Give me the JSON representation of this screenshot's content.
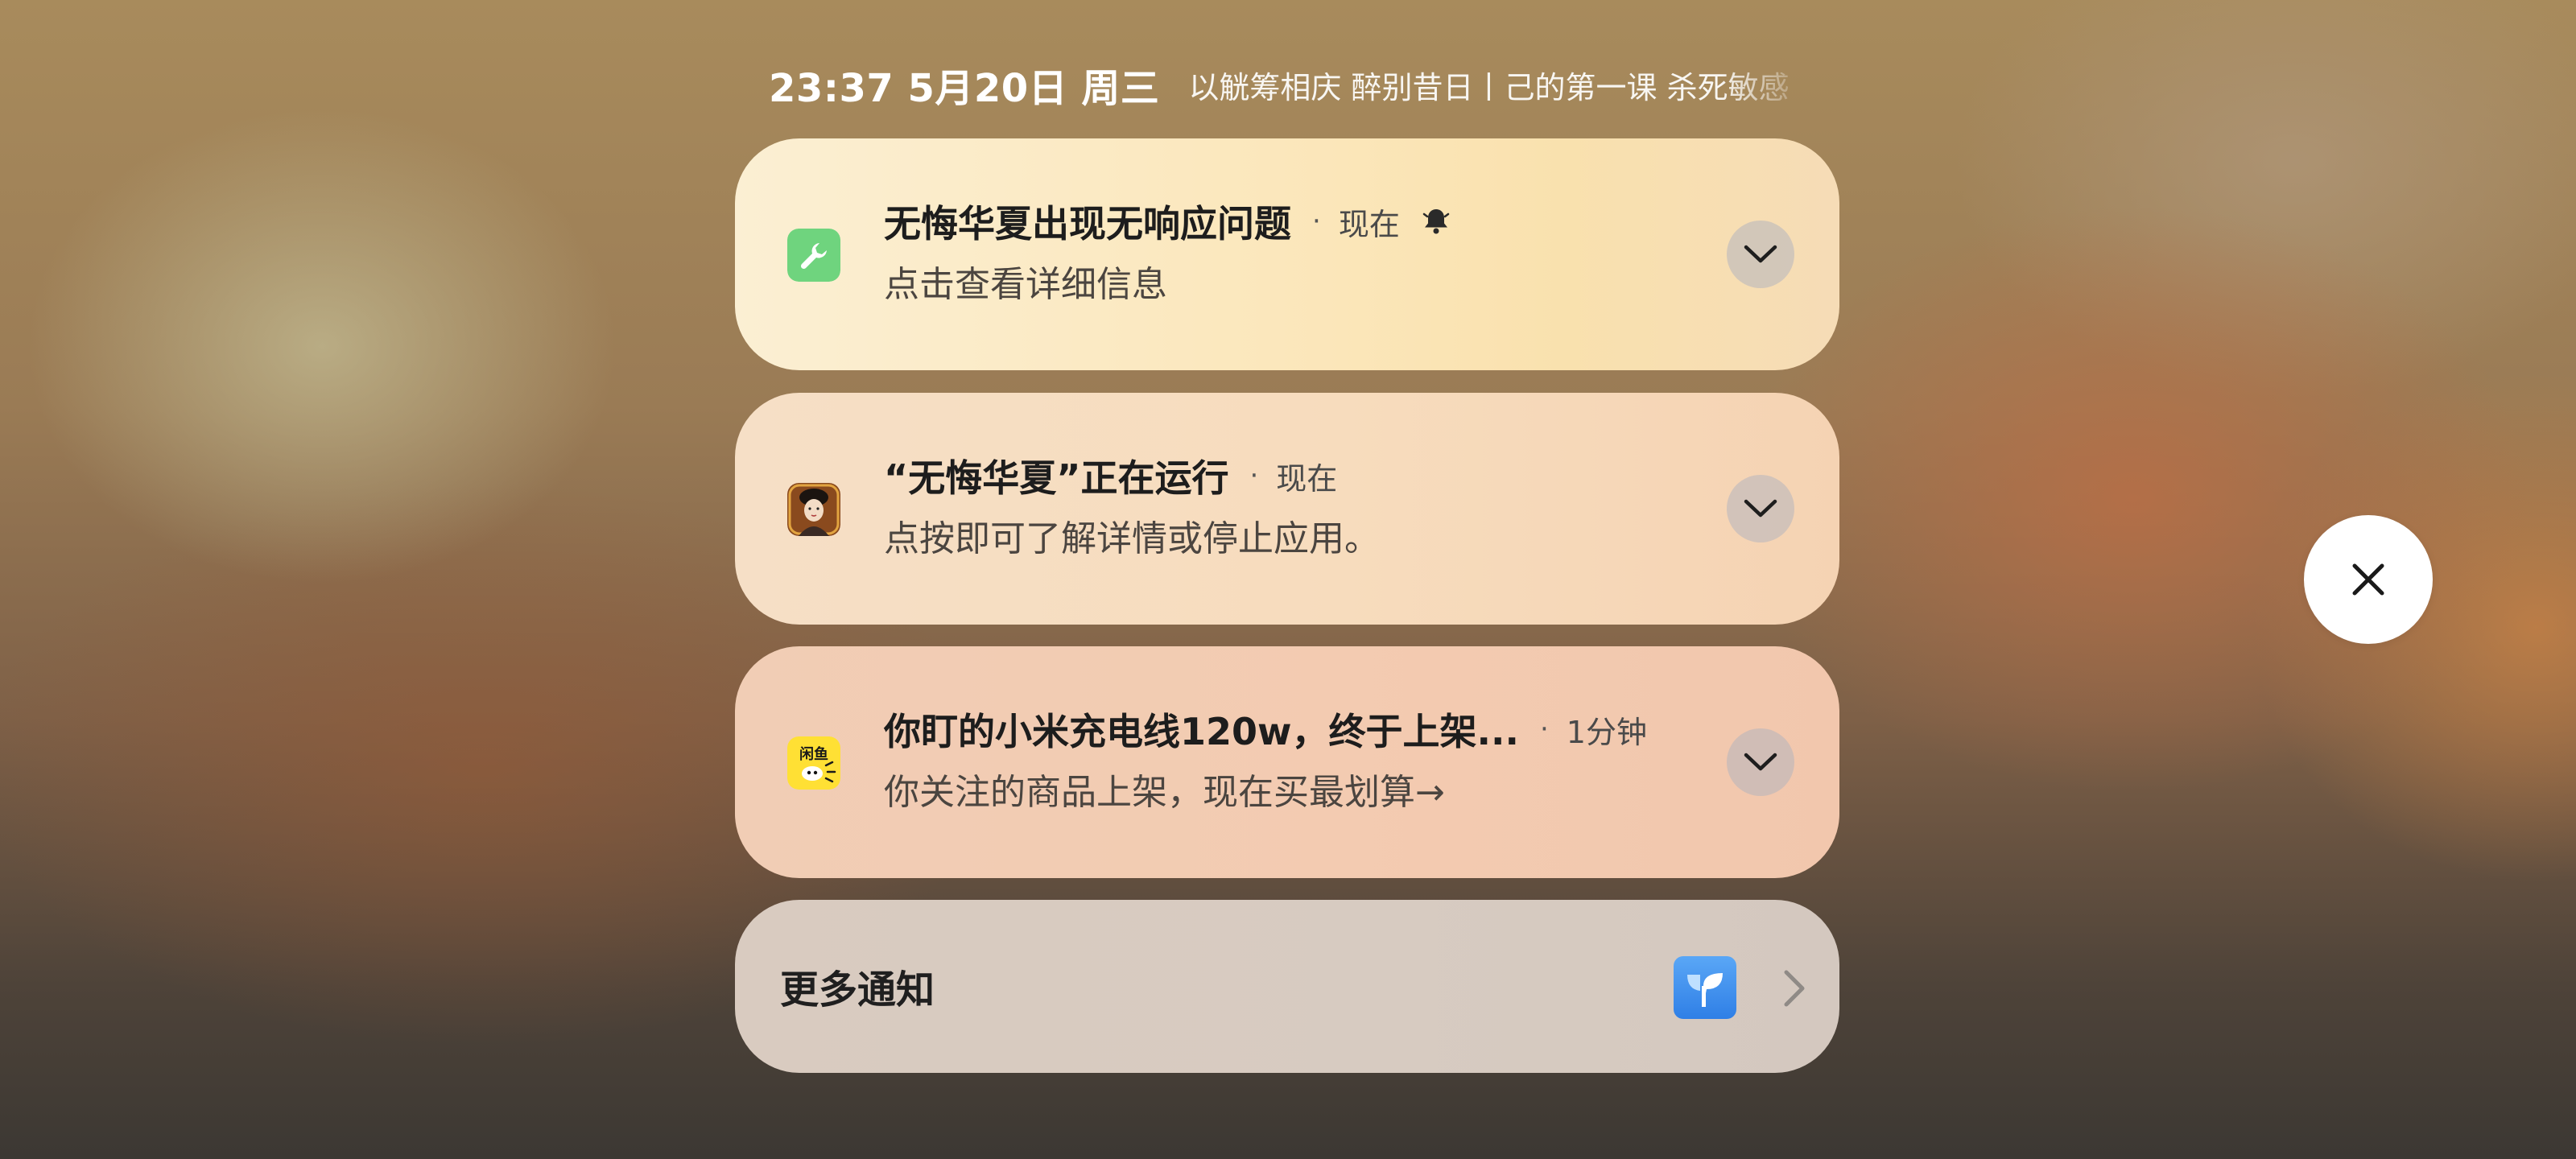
{
  "status_bar": {
    "clock": "23:37 5月20日 周三",
    "ticker": "以觥筹相庆 醉别昔日丨己的第一课 杀死敏感"
  },
  "notifications": [
    {
      "app_icon": "wrench-icon",
      "title": "无悔华夏出现无响应问题",
      "time": "现在",
      "has_bell": true,
      "body": "点击查看详细信息"
    },
    {
      "app_icon": "game-portrait-icon",
      "title": "“无悔华夏”正在运行",
      "time": "现在",
      "has_bell": false,
      "body": "点按即可了解详情或停止应用。"
    },
    {
      "app_icon": "xianyu-icon",
      "icon_text": "闲鱼",
      "title": "你盯的小米充电线120w，终于上架...",
      "time": "1分钟",
      "has_bell": false,
      "body": "你关注的商品上架，现在买最划算→"
    }
  ],
  "more_notifications": {
    "label": "更多通知",
    "icon": "sprout-icon"
  },
  "close_button": {
    "icon": "close-icon"
  },
  "colors": {
    "accent_green": "#6fd47e",
    "more_icon_blue": "#3a8cee",
    "xianyu_yellow": "#ffe034"
  }
}
